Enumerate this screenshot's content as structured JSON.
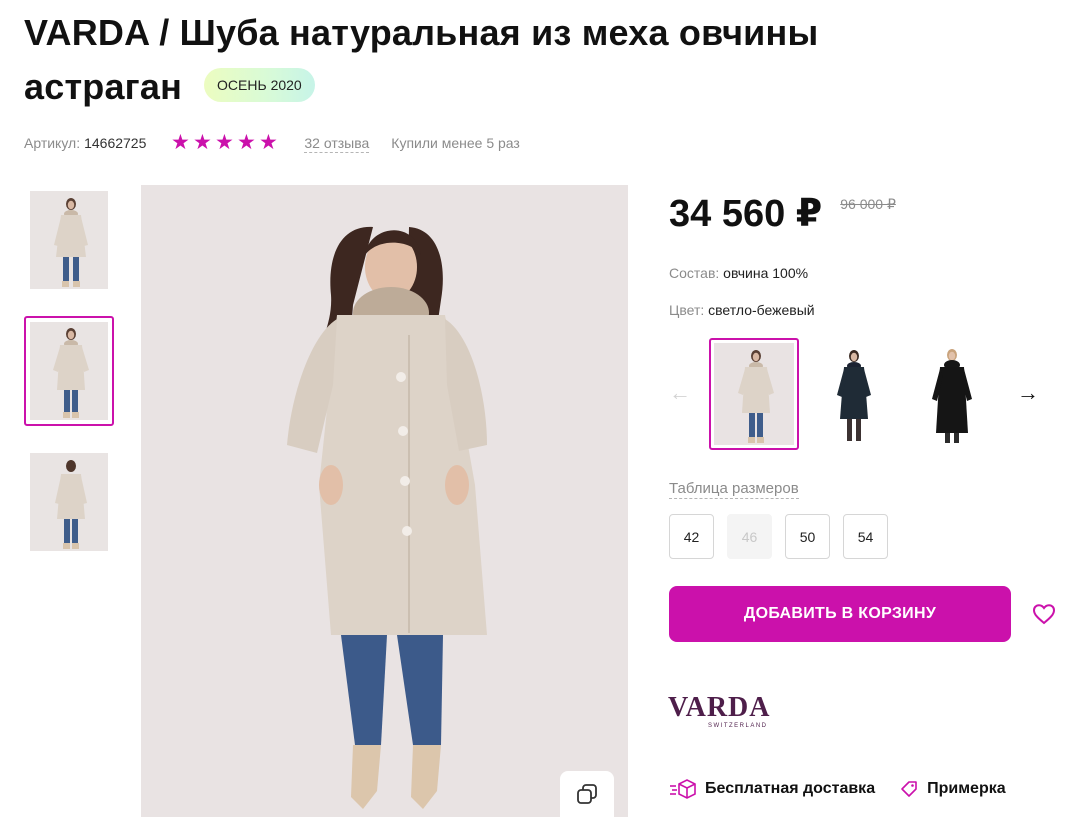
{
  "product": {
    "title": "VARDA / Шуба натуральная из меха овчины астраган",
    "season_badge": "ОСЕНЬ 2020"
  },
  "meta": {
    "sku_label": "Артикул:",
    "sku_value": "14662725",
    "rating_stars": 5,
    "reviews_link": "32 отзыва",
    "purchases": "Купили менее 5 раз"
  },
  "gallery": {
    "thumbnails": [
      "photo-front",
      "photo-front-open",
      "photo-back"
    ],
    "active_index": 1,
    "copy_icon": "copy-icon"
  },
  "pricing": {
    "current": "34 560 ₽",
    "old": "96 000 ₽"
  },
  "attributes": {
    "composition_label": "Состав:",
    "composition_value": "овчина 100%",
    "color_label": "Цвет:",
    "color_value": "светло-бежевый"
  },
  "color_variants": {
    "items": [
      "светло-бежевый",
      "тёмно-синий",
      "чёрный"
    ],
    "active_index": 0,
    "prev_icon": "arrow-left-icon",
    "next_icon": "arrow-right-icon"
  },
  "sizes": {
    "table_link": "Таблица размеров",
    "options": [
      {
        "label": "42",
        "available": true
      },
      {
        "label": "46",
        "available": false
      },
      {
        "label": "50",
        "available": true
      },
      {
        "label": "54",
        "available": true
      }
    ]
  },
  "actions": {
    "add_to_cart": "ДОБАВИТЬ В КОРЗИНУ",
    "favorite_icon": "heart-icon"
  },
  "brand": {
    "logo_text": "VARDA",
    "logo_subtext": "SWITZERLAND"
  },
  "perks": {
    "delivery": "Бесплатная доставка",
    "fitting": "Примерка"
  },
  "colors": {
    "accent": "#cb11ab",
    "muted_text": "#8b8b8b",
    "badge_from": "#ecfcc0",
    "badge_to": "#c7f4e8"
  }
}
